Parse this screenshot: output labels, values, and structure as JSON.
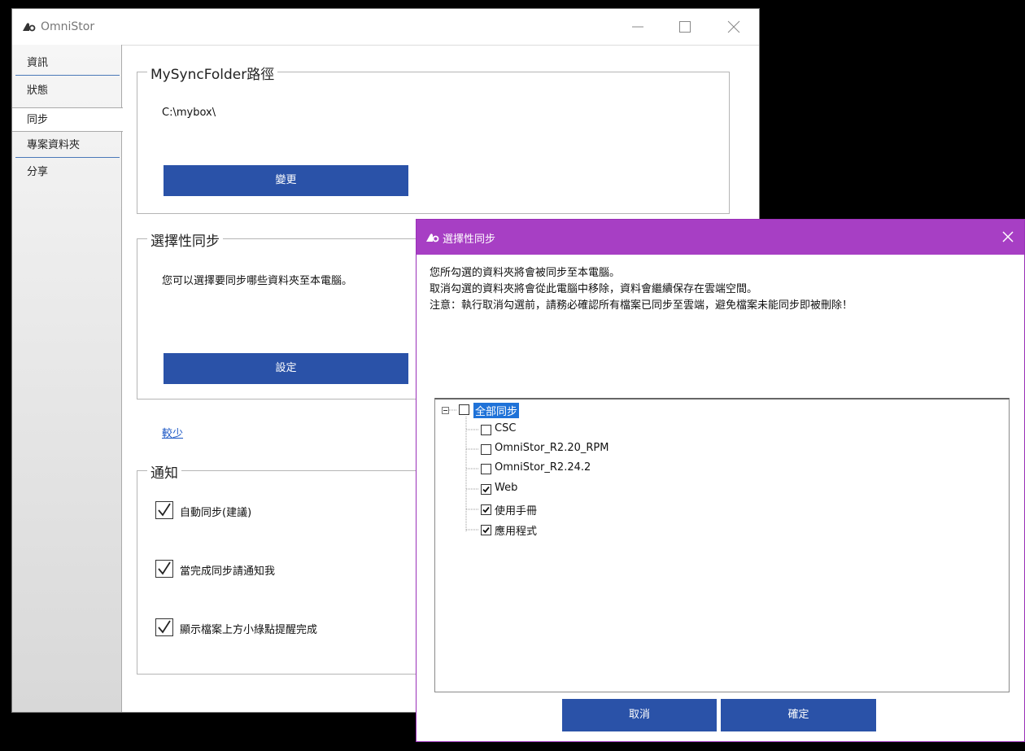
{
  "app": {
    "title": "OmniStor"
  },
  "sidebar": {
    "items": [
      {
        "label": "資訊"
      },
      {
        "label": "狀態"
      },
      {
        "label": "同步"
      },
      {
        "label": "專案資料夾"
      },
      {
        "label": "分享"
      }
    ],
    "active": "同步"
  },
  "sync_folder": {
    "group_title": "MySyncFolder路徑",
    "path": "C:\\mybox\\",
    "change_button": "變更"
  },
  "selective_sync": {
    "group_title": "選擇性同步",
    "description": "您可以選擇要同步哪些資料夾至本電腦。",
    "settings_button": "設定"
  },
  "less_link": "較少",
  "notifications": {
    "group_title": "通知",
    "options": [
      {
        "label": "自動同步(建議)",
        "checked": true
      },
      {
        "label": "當完成同步請通知我",
        "checked": true
      },
      {
        "label": "顯示檔案上方小綠點提醒完成",
        "checked": true
      }
    ]
  },
  "dialog": {
    "title": "選擇性同步",
    "notice_lines": [
      "您所勾選的資料夾將會被同步至本電腦。",
      "取消勾選的資料夾將會從此電腦中移除，資料會繼續保存在雲端空間。",
      "注意：執行取消勾選前，請務必確認所有檔案已同步至雲端，避免檔案未能同步即被刪除！"
    ],
    "tree": {
      "root": {
        "label": "全部同步",
        "checked": false,
        "expanded": true
      },
      "children": [
        {
          "label": "CSC",
          "checked": false
        },
        {
          "label": "OmniStor_R2.20_RPM",
          "checked": false
        },
        {
          "label": "OmniStor_R2.24.2",
          "checked": false
        },
        {
          "label": "Web",
          "checked": true
        },
        {
          "label": "使用手冊",
          "checked": true
        },
        {
          "label": "應用程式",
          "checked": true
        }
      ]
    },
    "cancel_button": "取消",
    "ok_button": "確定"
  },
  "colors": {
    "dialog_titlebar": "#a73fc4",
    "primary_button": "#2a52a8",
    "tree_selection": "#1f72d8",
    "link": "#1a56c4"
  }
}
